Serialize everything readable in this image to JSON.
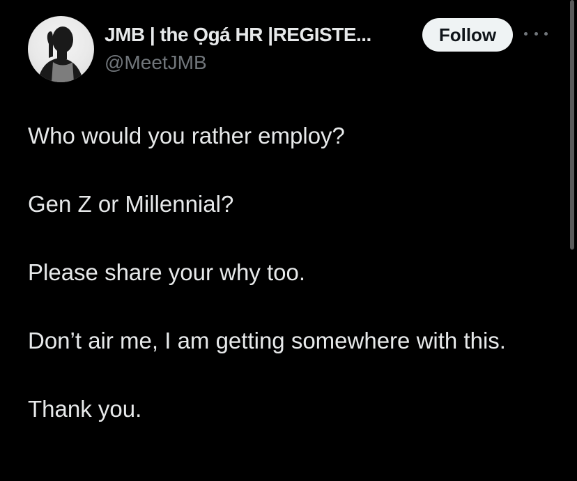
{
  "author": {
    "display_name": "JMB | the Ọgá HR |REGISTE...",
    "handle": "@MeetJMB",
    "avatar_icon": "profile-photo-silhouette"
  },
  "actions": {
    "follow_label": "Follow",
    "more_icon": "ellipsis-horizontal-icon"
  },
  "tweet": {
    "paragraphs": [
      "Who would you rather employ?",
      "Gen Z or Millennial?",
      "Please share your why too.",
      "Don’t air me, I am getting somewhere with this.",
      "Thank you."
    ]
  },
  "colors": {
    "background": "#000000",
    "text_primary": "#e7e9ea",
    "text_secondary": "#71767b",
    "button_bg": "#eff3f4",
    "button_text": "#0f1419"
  }
}
